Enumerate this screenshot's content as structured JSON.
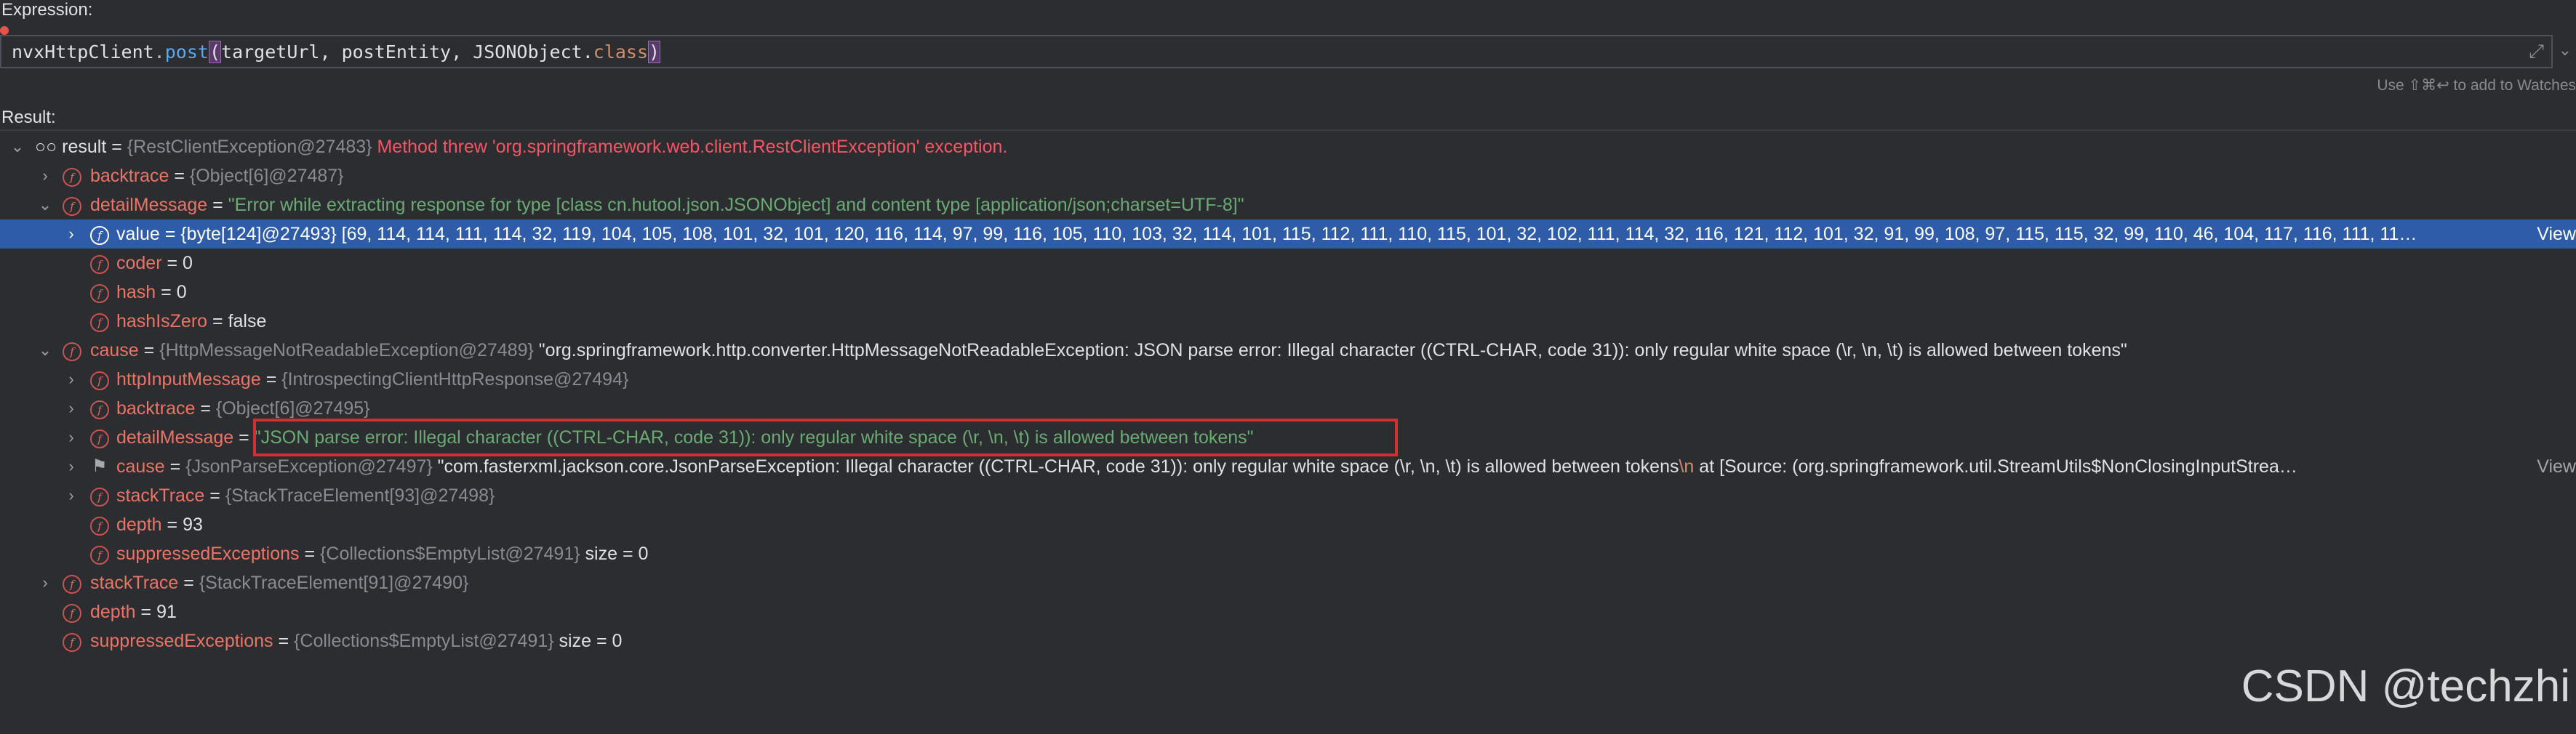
{
  "expression": {
    "label": "Expression:",
    "code_receiver": "nvxHttpClient",
    "code_dot": ".",
    "code_method": "post",
    "code_open": "(",
    "code_args": "targetUrl, postEntity, JSONObject.",
    "code_class_kw": "class",
    "code_close": ")",
    "hint": "Use ⇧⌘↩ to add to Watches",
    "expand_icon": "expand-icon",
    "dropdown_icon": "chevron-down-icon"
  },
  "result_label": "Result:",
  "tree": {
    "r0": {
      "name": "result",
      "eq": " = ",
      "ref": "{RestClientException@27483}",
      "msg": " Method threw 'org.springframework.web.client.RestClientException' exception."
    },
    "r1": {
      "name": "backtrace",
      "eq": " = ",
      "ref": "{Object[6]@27487}"
    },
    "r2": {
      "name": "detailMessage",
      "eq": " = ",
      "str": "\"Error while extracting response for type [class cn.hutool.json.JSONObject] and content type [application/json;charset=UTF-8]\""
    },
    "r3": {
      "name": "value",
      "eq": " = ",
      "ref": "{byte[124]@27493}",
      "val": " [69, 114, 114, 111, 114, 32, 119, 104, 105, 108, 101, 32, 101, 120, 116, 114, 97, 99, 116, 105, 110, 103, 32, 114, 101, 115, 112, 111, 110, 115, 101, 32, 102, 111, 114, 32, 116, 121, 112, 101, 32, 91, 99, 108, 97, 115, 115, 32, 99, 110, 46, 104, 117, 116, 111, 11…",
      "view": "View"
    },
    "r4": {
      "name": "coder",
      "eq": " = ",
      "val": "0"
    },
    "r5": {
      "name": "hash",
      "eq": " = ",
      "val": "0"
    },
    "r6": {
      "name": "hashIsZero",
      "eq": " = ",
      "val": "false"
    },
    "r7": {
      "name": "cause",
      "eq": " = ",
      "ref": "{HttpMessageNotReadableException@27489}",
      "str": " \"org.springframework.http.converter.HttpMessageNotReadableException: JSON parse error: Illegal character ((CTRL-CHAR, code 31)): only regular white space (\\r, \\n, \\t) is allowed between tokens\""
    },
    "r8": {
      "name": "httpInputMessage",
      "eq": " = ",
      "ref": "{IntrospectingClientHttpResponse@27494}"
    },
    "r9": {
      "name": "backtrace",
      "eq": " = ",
      "ref": "{Object[6]@27495}"
    },
    "r10": {
      "name": "detailMessage",
      "eq": " = ",
      "str": "\"JSON parse error: Illegal character ((CTRL-CHAR, code 31)): only regular white space (\\r, \\n, \\t) is allowed between tokens\""
    },
    "r11": {
      "name": "cause",
      "eq": " = ",
      "ref": "{JsonParseException@27497}",
      "str_a": " \"com.fasterxml.jackson.core.JsonParseException: Illegal character ((CTRL-CHAR, code 31)): only regular white space (\\r, \\n, \\t) is allowed between tokens",
      "esc": "\\n",
      "str_b": " at [Source: (org.springframework.util.StreamUtils$NonClosingInputStrea…",
      "view": "View"
    },
    "r12": {
      "name": "stackTrace",
      "eq": " = ",
      "ref": "{StackTraceElement[93]@27498}"
    },
    "r13": {
      "name": "depth",
      "eq": " = ",
      "val": "93"
    },
    "r14": {
      "name": "suppressedExceptions",
      "eq": " = ",
      "ref": "{Collections$EmptyList@27491}",
      "val": "  size = 0"
    },
    "r15": {
      "name": "stackTrace",
      "eq": " = ",
      "ref": "{StackTraceElement[91]@27490}"
    },
    "r16": {
      "name": "depth",
      "eq": " = ",
      "val": "91"
    },
    "r17": {
      "name": "suppressedExceptions",
      "eq": " = ",
      "ref": "{Collections$EmptyList@27491}",
      "val": "  size = 0"
    }
  },
  "field_badge": "f",
  "watermark": "CSDN @techzhi",
  "colors": {
    "selection": "#2e5ca8",
    "highlight_border": "#d0312d",
    "error_text": "#f75464"
  }
}
